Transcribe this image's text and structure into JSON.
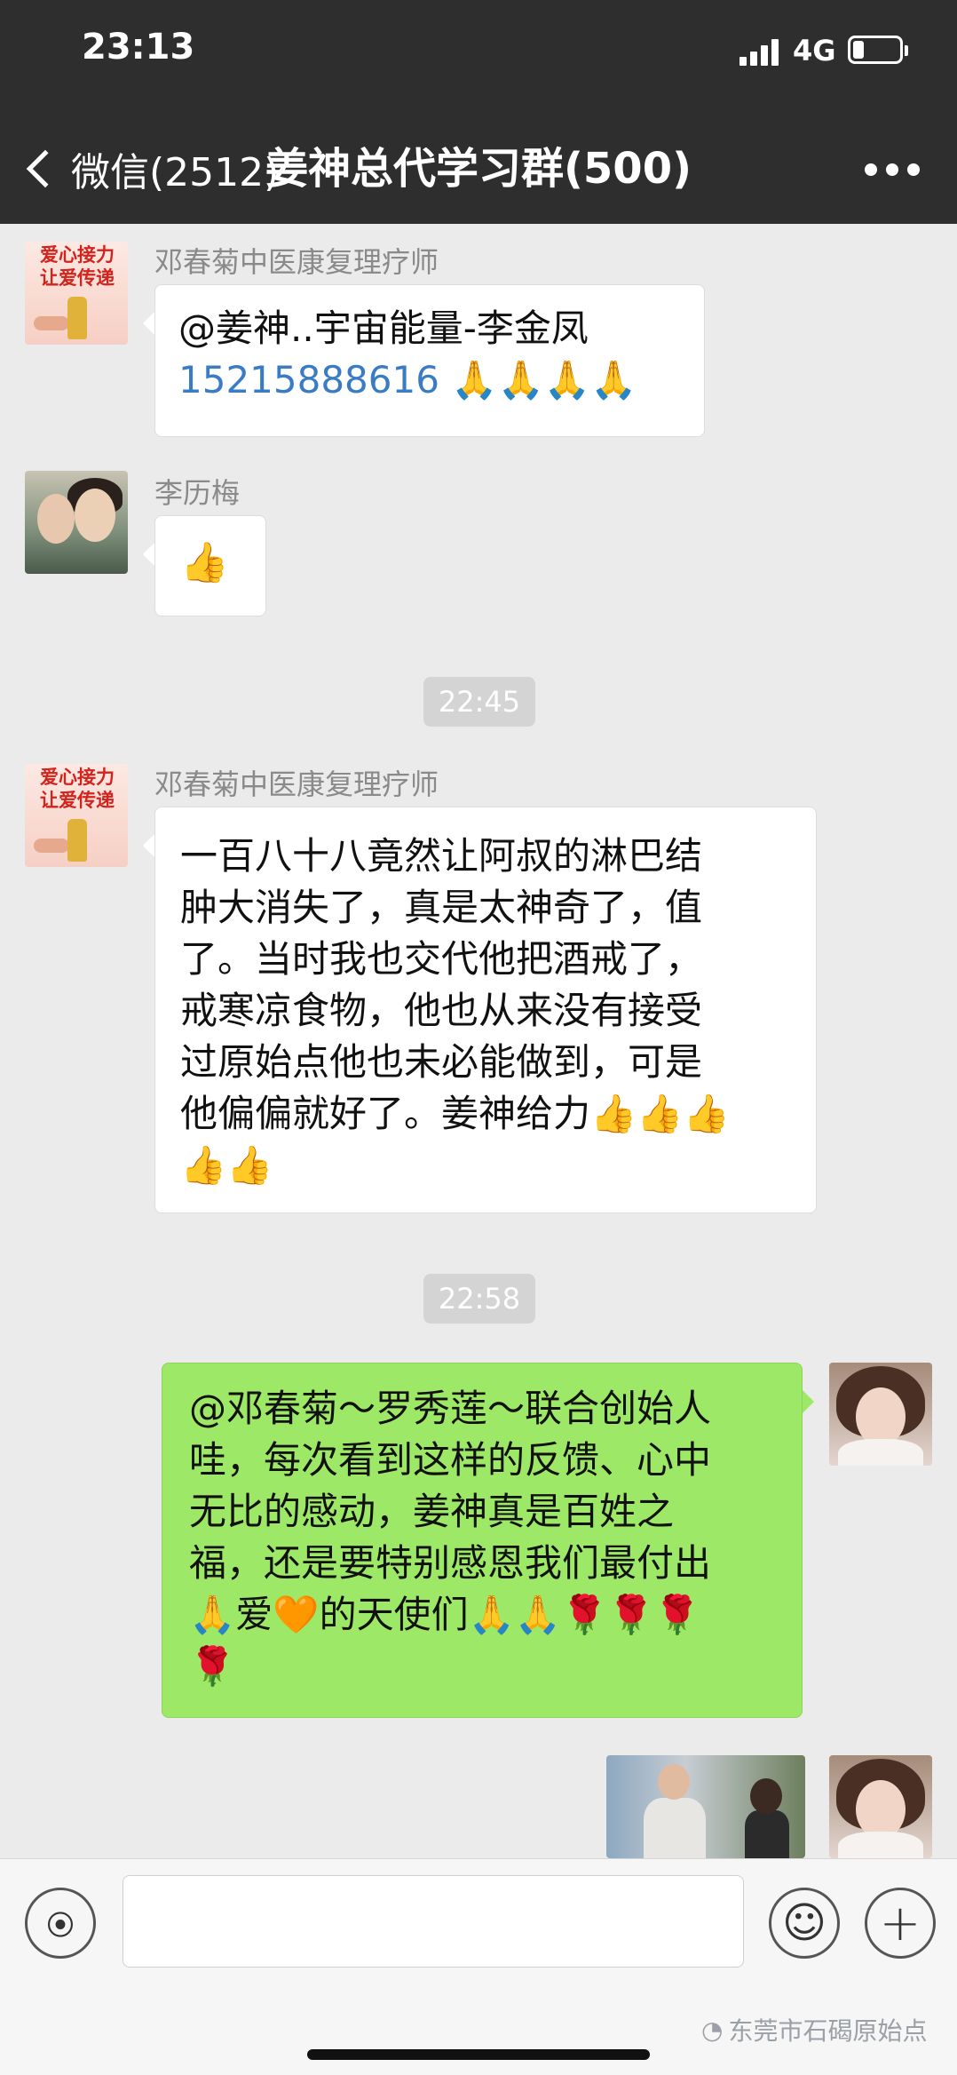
{
  "status_bar": {
    "time": "23:13",
    "network": "4G"
  },
  "header": {
    "back_label": "微信(2512)",
    "title": "姜神总代学习群(500)",
    "more_icon": "more-dots-icon"
  },
  "messages": [
    {
      "sender": "邓春菊中医康复理疗师",
      "avatar_text": "爱心接力 让爱传递",
      "line1": "@姜神..宇宙能量-李金凤",
      "phone": "15215888616",
      "emoji": "🙏🙏🙏🙏"
    },
    {
      "sender": "李历梅",
      "emoji": "👍"
    },
    {
      "time": "22:45"
    },
    {
      "sender": "邓春菊中医康复理疗师",
      "avatar_text": "爱心接力 让爱传递",
      "lines": [
        "一百八十八竟然让阿叔的淋巴结",
        "肿大消失了，真是太神奇了，值",
        "了。当时我也交代他把酒戒了，",
        "戒寒凉食物，他也从来没有接受",
        "过原始点他也未必能做到，可是",
        "他偏偏就好了。姜神给力👍👍👍",
        "👍👍"
      ]
    },
    {
      "time": "22:58"
    },
    {
      "sender": "self",
      "lines": [
        "@邓春菊～罗秀莲～联合创始人",
        "哇，每次看到这样的反馈、心中",
        "无比的感动，姜神真是百姓之",
        "福，还是要特别感恩我们最付出",
        "🙏爱🧡的天使们🙏🙏🌹🌹🌹",
        "🌹"
      ]
    }
  ],
  "watermark": "东莞市石碣原始点"
}
